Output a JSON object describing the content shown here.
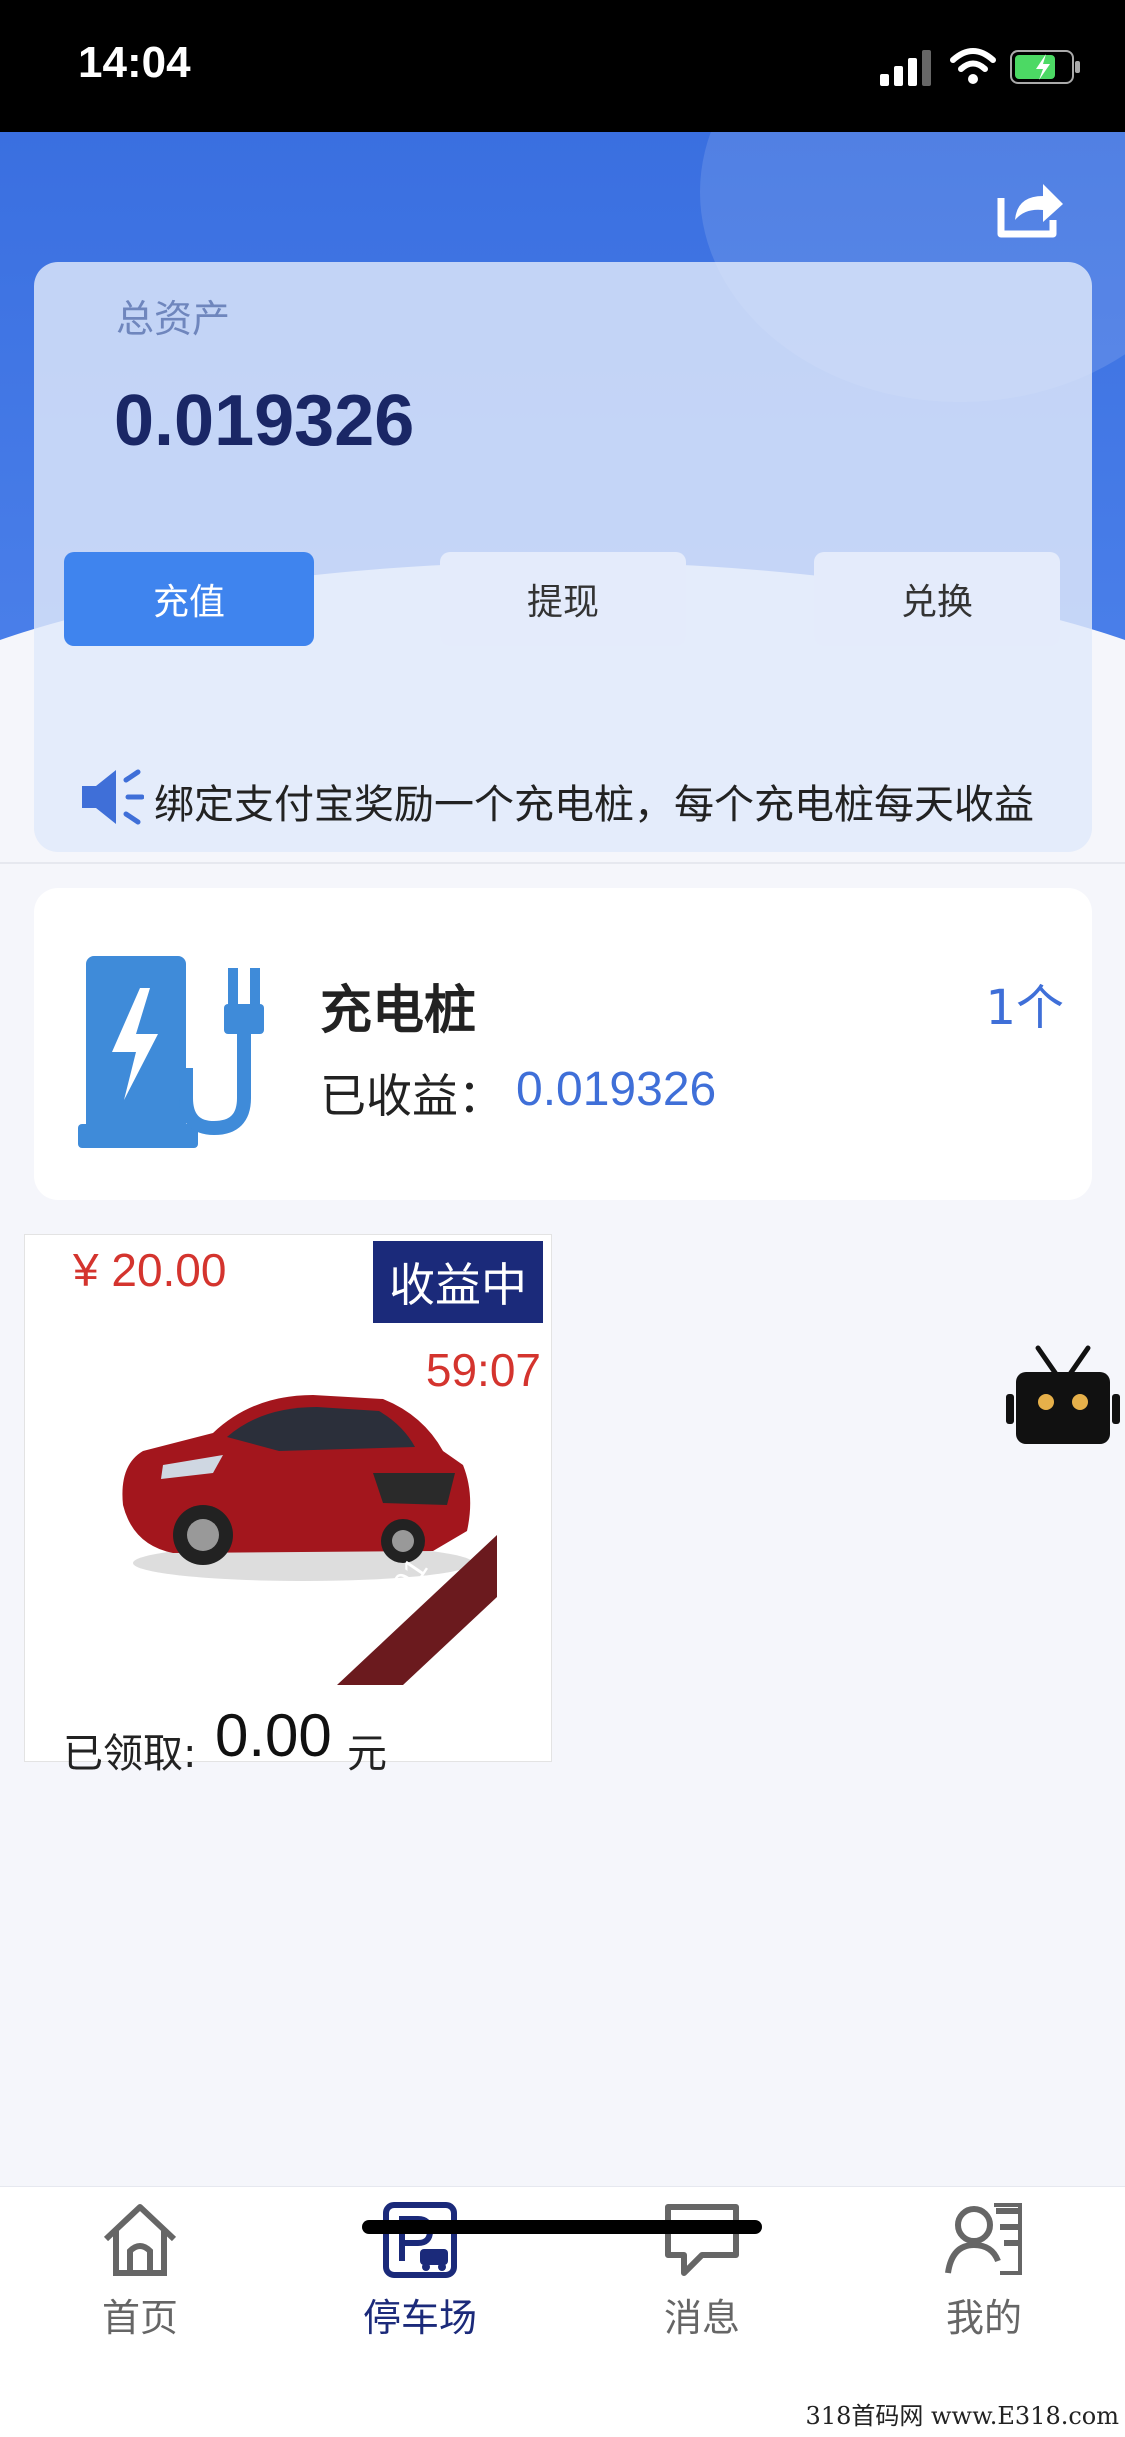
{
  "status_bar": {
    "time": "14:04"
  },
  "assets": {
    "label": "总资产",
    "value": "0.019326",
    "buttons": {
      "recharge": "充值",
      "withdraw": "提现",
      "exchange": "兑换"
    }
  },
  "notice": {
    "text": "绑定支付宝奖励一个充电桩，每个充电桩每天收益"
  },
  "charger": {
    "title": "充电桩",
    "count": "1个",
    "earned_label": "已收益：",
    "earned_value": "0.019326"
  },
  "car": {
    "price": "¥ 20.00",
    "status": "收益中",
    "timer": "59:07",
    "plate": "MI001",
    "claimed_label": "已领取:",
    "claimed_value": "0.00",
    "claimed_unit": "元"
  },
  "tabs": [
    {
      "label": "首页",
      "icon": "home-icon"
    },
    {
      "label": "停车场",
      "icon": "parking-icon",
      "active": true
    },
    {
      "label": "消息",
      "icon": "message-icon"
    },
    {
      "label": "我的",
      "icon": "profile-icon"
    }
  ],
  "watermark": "318首码网 www.E318.com",
  "colors": {
    "primary": "#3f84ee",
    "header": "#3a6fe0",
    "accent_red": "#d4342e",
    "navy": "#1b2a7a"
  }
}
